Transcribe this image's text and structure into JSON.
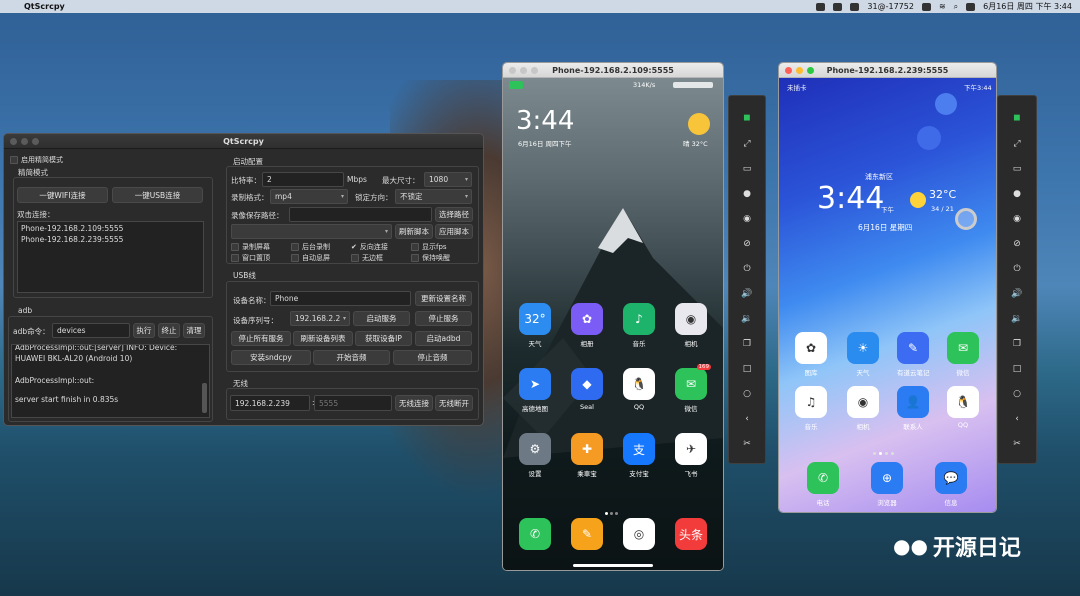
{
  "menubar": {
    "app_name": "QtScrcpy",
    "status_text": "31@-17752",
    "datetime": "6月16日 周四 下午 3:44"
  },
  "main_window": {
    "title": "QtScrcpy",
    "simple_mode_checkbox": "启用精简模式",
    "simple_mode_group": "精简模式",
    "wifi_connect_btn": "一键WIFI连接",
    "usb_connect_btn": "一键USB连接",
    "double_click_label": "双击连接：",
    "devices": [
      "Phone-192.168.2.109:5555",
      "Phone-192.168.2.239:5555"
    ],
    "adb_group": "adb",
    "adb_cmd_label": "adb命令：",
    "adb_cmd_value": "devices",
    "execute_btn": "执行",
    "stop_btn": "终止",
    "clear_btn": "清理",
    "log_lines": [
      "AdbProcessImpl::out:[server] INFO: Device:",
      "HUAWEI BKL-AL20 (Android 10)",
      "",
      "AdbProcessImpl::out:",
      "",
      "server start finish in 0.835s"
    ],
    "config_group": "启动配置",
    "bitrate_label": "比特率：",
    "bitrate_value": "2",
    "bitrate_unit": "Mbps",
    "max_size_label": "最大尺寸：",
    "max_size_value": "1080",
    "record_format_label": "录制格式：",
    "record_format_value": "mp4",
    "lock_orientation_label": "锁定方向：",
    "lock_orientation_value": "不锁定",
    "record_path_label": "录像保存路径：",
    "select_path_btn": "选择路径",
    "refresh_script_btn": "刷新脚本",
    "apply_script_btn": "应用脚本",
    "options": [
      {
        "label": "录制屏幕",
        "checked": false
      },
      {
        "label": "后台录制",
        "checked": false
      },
      {
        "label": "反向连接",
        "checked": true
      },
      {
        "label": "显示fps",
        "checked": false
      },
      {
        "label": "窗口置顶",
        "checked": false
      },
      {
        "label": "自动息屏",
        "checked": false
      },
      {
        "label": "无边框",
        "checked": false
      },
      {
        "label": "保持唤醒",
        "checked": false
      }
    ],
    "usb_group": "USB线",
    "device_name_label": "设备名称：",
    "device_name_value": "Phone",
    "update_name_btn": "更新设置名称",
    "serial_label": "设备序列号：",
    "serial_value": "192.168.2.2",
    "start_service_btn": "启动服务",
    "stop_service_btn": "停止服务",
    "stop_all_btn": "停止所有服务",
    "refresh_devices_btn": "刷新设备列表",
    "get_ip_btn": "获取设备IP",
    "start_adbd_btn": "启动adbd",
    "install_sndcpy_btn": "安装sndcpy",
    "start_audio_btn": "开始音频",
    "stop_audio_btn": "停止音频",
    "wireless_group": "无线",
    "ip_value": "192.168.2.239",
    "port_placeholder": "5555",
    "wireless_connect_btn": "无线连接",
    "wireless_disconnect_btn": "无线断开"
  },
  "phone1": {
    "title": "Phone-192.168.2.109:5555",
    "status_speed": "314K/s",
    "clock": "3:44",
    "date": "6月16日 周四下午",
    "weather": "晴  32°C",
    "apps": [
      {
        "name": "天气",
        "color": "#2d8cf0",
        "glyph": "32°"
      },
      {
        "name": "相册",
        "color": "#7b5cf5",
        "glyph": "✿"
      },
      {
        "name": "音乐",
        "color": "#1db36a",
        "glyph": "♪"
      },
      {
        "name": "相机",
        "color": "#e8e8ee",
        "glyph": "◉"
      },
      {
        "name": "高德地图",
        "color": "#2b7bf2",
        "glyph": "➤"
      },
      {
        "name": "Seal",
        "color": "#2f6bf0",
        "glyph": "◆"
      },
      {
        "name": "QQ",
        "color": "#ffffff",
        "glyph": "🐧"
      },
      {
        "name": "微信",
        "color": "#2dc25a",
        "glyph": "✉"
      },
      {
        "name": "设置",
        "color": "#6d7a86",
        "glyph": "⚙"
      },
      {
        "name": "乘車宝",
        "color": "#f59a23",
        "glyph": "✚"
      },
      {
        "name": "支付宝",
        "color": "#1677ff",
        "glyph": "支"
      },
      {
        "name": "飞书",
        "color": "#ffffff",
        "glyph": "✈"
      }
    ],
    "badge": "169",
    "dock": [
      {
        "name": "phone",
        "color": "#2dc25a",
        "glyph": "✆"
      },
      {
        "name": "notes",
        "color": "#f7a21b",
        "glyph": "✎"
      },
      {
        "name": "chrome",
        "color": "#ffffff",
        "glyph": "◎"
      },
      {
        "name": "toutiao",
        "color": "#f23b3b",
        "glyph": "头条"
      }
    ]
  },
  "phone2": {
    "title": "Phone-192.168.2.239:5555",
    "carrier": "未插卡",
    "status_time": "下午3:44",
    "location": "浦东新区",
    "clock": "3:44",
    "clock_ampm": "下午",
    "temp": "32°C",
    "temp_range": "34 / 21",
    "date": "6月16日 星期四",
    "apps": [
      {
        "name": "图库",
        "color": "#ffffff",
        "glyph": "✿"
      },
      {
        "name": "天气",
        "color": "#2b8cf0",
        "glyph": "☀"
      },
      {
        "name": "有道云笔记",
        "color": "#3b6cf2",
        "glyph": "✎"
      },
      {
        "name": "微信",
        "color": "#2dc25a",
        "glyph": "✉"
      },
      {
        "name": "音乐",
        "color": "#ffffff",
        "glyph": "♫"
      },
      {
        "name": "相机",
        "color": "#ffffff",
        "glyph": "◉"
      },
      {
        "name": "联系人",
        "color": "#2b7bf2",
        "glyph": "👤"
      },
      {
        "name": "QQ",
        "color": "#ffffff",
        "glyph": "🐧"
      }
    ],
    "dock": [
      {
        "name": "电话",
        "color": "#2dc25a",
        "glyph": "✆"
      },
      {
        "name": "浏览器",
        "color": "#2b7bf2",
        "glyph": "⊕"
      },
      {
        "name": "信息",
        "color": "#2b7bf2",
        "glyph": "💬"
      }
    ]
  },
  "watermark": "开源日记"
}
